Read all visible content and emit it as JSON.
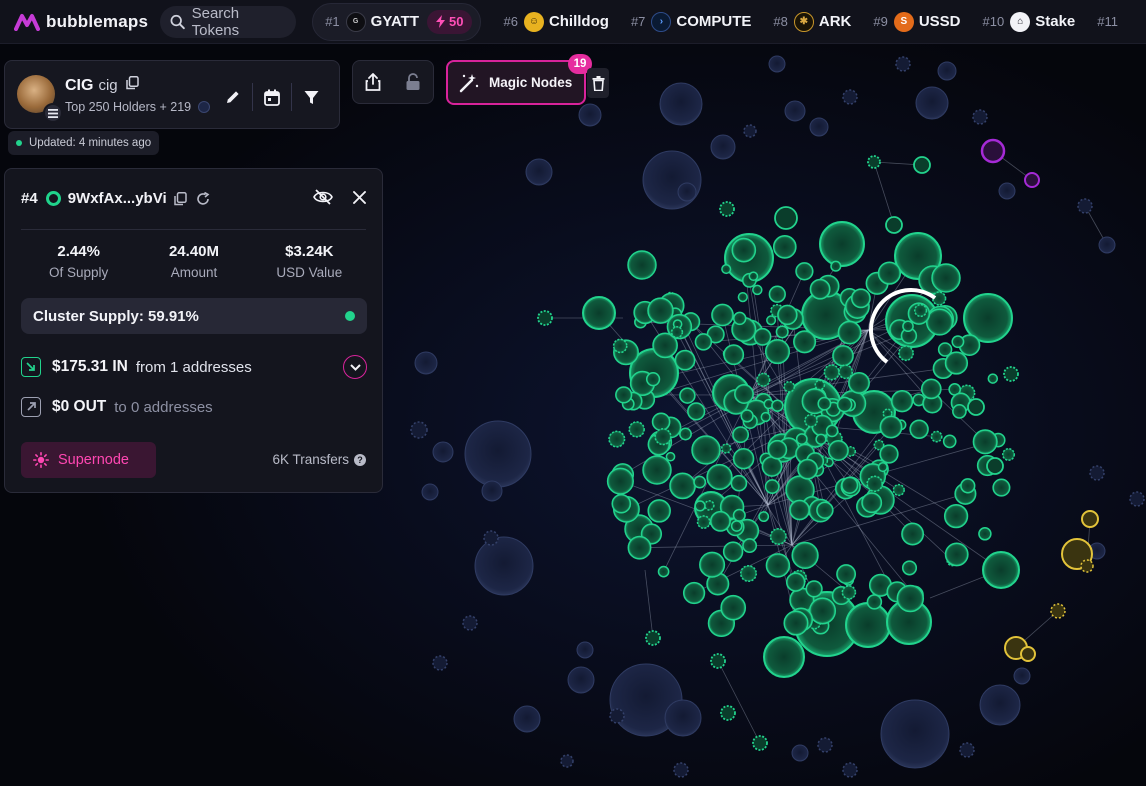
{
  "app": {
    "name": "bubblemaps"
  },
  "search": {
    "placeholder": "Search Tokens"
  },
  "trending": [
    {
      "rank": "#1",
      "name": "GYATT",
      "badge": "50",
      "icon": "gyatt-logo",
      "color": "#0e0e12"
    },
    {
      "rank": "#6",
      "name": "Chilldog",
      "icon": "chilldog-logo",
      "color": "#e8b220"
    },
    {
      "rank": "#7",
      "name": "COMPUTE",
      "icon": "compute-logo",
      "color": "#0a1a33"
    },
    {
      "rank": "#8",
      "name": "ARK",
      "icon": "ark-logo",
      "color": "#1a1406"
    },
    {
      "rank": "#9",
      "name": "USSD",
      "icon": "ussd-logo",
      "color": "#e36b1a"
    },
    {
      "rank": "#10",
      "name": "Stake",
      "icon": "stake-logo",
      "color": "#f2f2f7"
    },
    {
      "rank": "#11",
      "name": "",
      "icon": "",
      "color": "#666"
    }
  ],
  "token": {
    "symbol": "CIG",
    "name": "cig",
    "holders": "Top 250 Holders + 219"
  },
  "updated": "Updated: 4 minutes ago",
  "magic": {
    "label": "Magic Nodes",
    "count": "19"
  },
  "wallet": {
    "rank": "#4",
    "address": "9WxfAx...ybVi",
    "stats": [
      {
        "value": "2.44%",
        "label": "Of Supply"
      },
      {
        "value": "24.40M",
        "label": "Amount"
      },
      {
        "value": "$3.24K",
        "label": "USD Value"
      }
    ],
    "cluster_supply": "Cluster Supply: 59.91%",
    "inflow": {
      "amount": "$175.31 IN",
      "text": "from 1 addresses"
    },
    "outflow": {
      "amount": "$0 OUT",
      "text": "to 0 addresses"
    },
    "supernode": "Supernode",
    "transfers": "6K Transfers"
  },
  "colors": {
    "accent": "#d8239b",
    "cluster_green": "#20d38c",
    "cluster_purple": "#a52ad6",
    "cluster_yellow": "#e2c33a",
    "background_bubble": "#1c2440"
  }
}
